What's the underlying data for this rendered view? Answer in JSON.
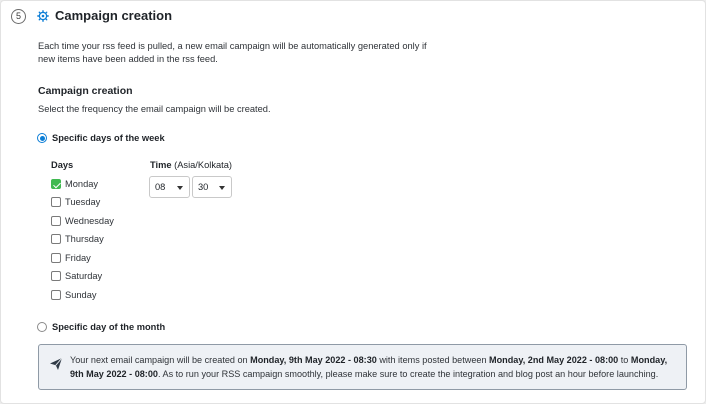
{
  "step": {
    "number": "5",
    "title": "Campaign creation",
    "icon": "settings-cog-icon",
    "accent": "#0b7dd6"
  },
  "description": "Each time your rss feed is pulled, a new email campaign will be automatically generated only if new items have been added in the rss feed.",
  "campaign": {
    "title": "Campaign creation",
    "subtitle": "Select the frequency the email campaign will be created."
  },
  "frequency": {
    "options": [
      {
        "label": "Specific days of the week",
        "selected": true
      },
      {
        "label": "Specific day of the month",
        "selected": false
      }
    ]
  },
  "days": {
    "label": "Days",
    "items": [
      {
        "label": "Monday",
        "checked": true
      },
      {
        "label": "Tuesday",
        "checked": false
      },
      {
        "label": "Wednesday",
        "checked": false
      },
      {
        "label": "Thursday",
        "checked": false
      },
      {
        "label": "Friday",
        "checked": false
      },
      {
        "label": "Saturday",
        "checked": false
      },
      {
        "label": "Sunday",
        "checked": false
      }
    ],
    "check_color": "#3fb950"
  },
  "time": {
    "label": "Time",
    "timezone": "(Asia/Kolkata)",
    "hour": "08",
    "minute": "30"
  },
  "notice": {
    "icon": "send-paper-plane-icon",
    "part1": "Your next email campaign will be created on ",
    "next_date": "Monday, 9th May 2022 - 08:30",
    "part2": " with items posted between ",
    "range_start": "Monday, 2nd May 2022 - 08:00",
    "part3": " to ",
    "range_end": "Monday, 9th May 2022 - 08:00",
    "part4": ". As to run your RSS campaign smoothly, please make sure to create the integration and blog post an hour before launching."
  }
}
